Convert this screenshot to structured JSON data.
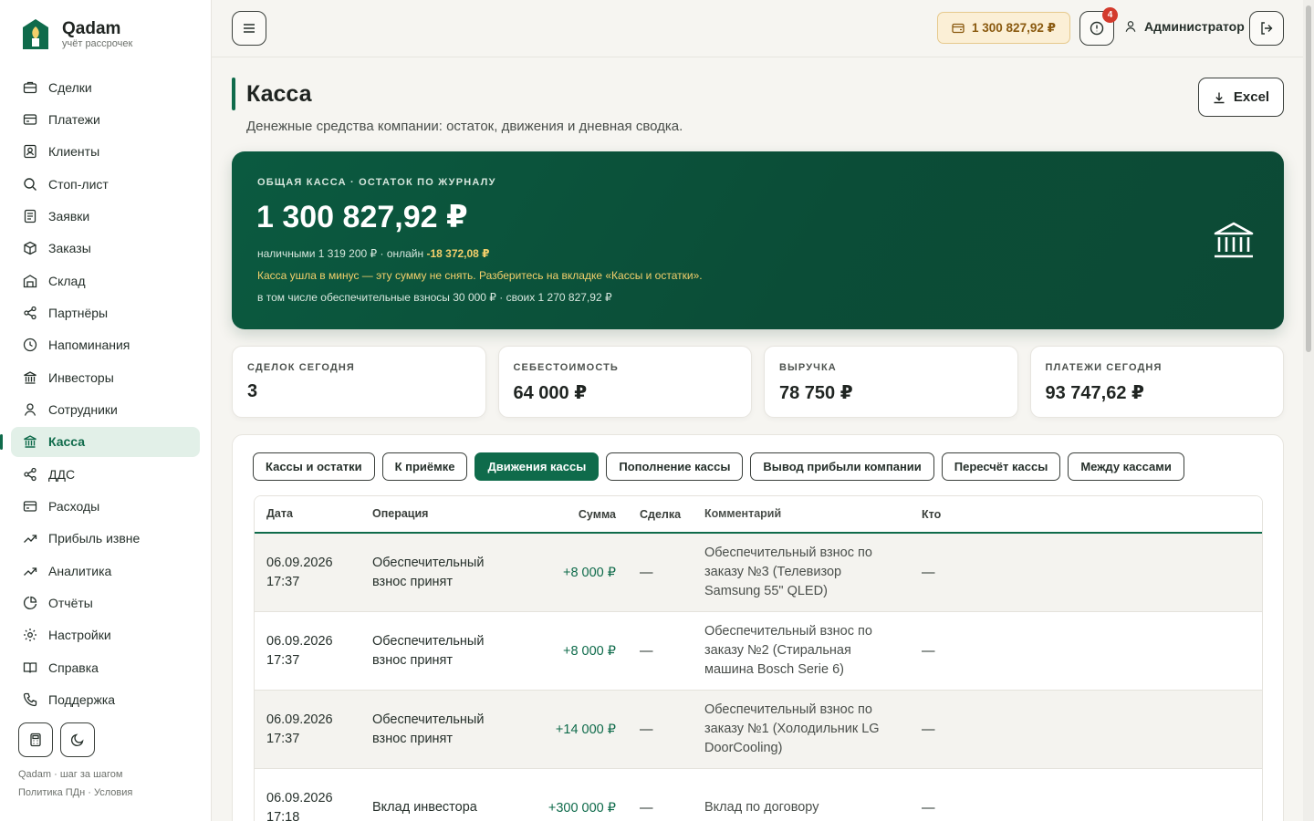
{
  "brand": {
    "name": "Qadam",
    "subtitle": "учёт рассрочек"
  },
  "sidebar": {
    "items": [
      {
        "label": "Сделки",
        "icon": "briefcase-icon"
      },
      {
        "label": "Платежи",
        "icon": "card-icon"
      },
      {
        "label": "Клиенты",
        "icon": "contact-icon"
      },
      {
        "label": "Стоп-лист",
        "icon": "search-icon"
      },
      {
        "label": "Заявки",
        "icon": "document-icon"
      },
      {
        "label": "Заказы",
        "icon": "box-icon"
      },
      {
        "label": "Склад",
        "icon": "warehouse-icon"
      },
      {
        "label": "Партнёры",
        "icon": "share-icon"
      },
      {
        "label": "Напоминания",
        "icon": "clock-icon"
      },
      {
        "label": "Инвесторы",
        "icon": "bank-icon"
      },
      {
        "label": "Сотрудники",
        "icon": "user-icon"
      },
      {
        "label": "Касса",
        "icon": "bank-icon",
        "active": true
      },
      {
        "label": "ДДС",
        "icon": "share-icon"
      },
      {
        "label": "Расходы",
        "icon": "card-icon"
      },
      {
        "label": "Прибыль извне",
        "icon": "trend-icon"
      },
      {
        "label": "Аналитика",
        "icon": "trend-icon"
      },
      {
        "label": "Отчёты",
        "icon": "pie-icon"
      },
      {
        "label": "Настройки",
        "icon": "gear-icon"
      },
      {
        "label": "Справка",
        "icon": "book-icon"
      },
      {
        "label": "Поддержка",
        "icon": "phone-icon"
      }
    ],
    "footer_line1": "Qadam · шаг за шагом",
    "footer_line2": "Политика ПДн · Условия"
  },
  "header": {
    "balance": "1 300 827,92 ₽",
    "alerts_count": "4",
    "user": "Администратор"
  },
  "page": {
    "title": "Касса",
    "subtitle": "Денежные средства компании: остаток, движения и дневная сводка.",
    "excel_label": "Excel"
  },
  "hero": {
    "label": "ОБЩАЯ КАССА · ОСТАТОК ПО ЖУРНАЛУ",
    "amount": "1 300 827,92 ₽",
    "split_prefix": "наличными 1 319 200 ₽ · онлайн ",
    "split_online": "-18 372,08 ₽",
    "warning": "Касса ушла в минус — эту сумму не снять. Разберитесь на вкладке «Кассы и остатки».",
    "deposits": "в том числе обеспечительные взносы 30 000 ₽ · своих 1 270 827,92 ₽"
  },
  "kpis": [
    {
      "label": "СДЕЛОК СЕГОДНЯ",
      "value": "3"
    },
    {
      "label": "СЕБЕСТОИМОСТЬ",
      "value": "64 000 ₽"
    },
    {
      "label": "ВЫРУЧКА",
      "value": "78 750 ₽"
    },
    {
      "label": "ПЛАТЕЖИ СЕГОДНЯ",
      "value": "93 747,62 ₽"
    }
  ],
  "tabs": [
    {
      "label": "Кассы и остатки"
    },
    {
      "label": "К приёмке"
    },
    {
      "label": "Движения кассы",
      "active": true
    },
    {
      "label": "Пополнение кассы"
    },
    {
      "label": "Вывод прибыли компании"
    },
    {
      "label": "Пересчёт кассы"
    },
    {
      "label": "Между кассами"
    }
  ],
  "table": {
    "columns": [
      "Дата",
      "Операция",
      "Сумма",
      "Сделка",
      "Комментарий",
      "Кто"
    ],
    "rows": [
      {
        "date": "06.09.2026",
        "time": "17:37",
        "op1": "Обеспечительный",
        "op2": "взнос принят",
        "sum": "+8 000 ₽",
        "deal": "—",
        "c1": "Обеспечительный взнос по",
        "c2": "заказу №3 (Телевизор",
        "c3": "Samsung 55\" QLED)",
        "who": "—"
      },
      {
        "date": "06.09.2026",
        "time": "17:37",
        "op1": "Обеспечительный",
        "op2": "взнос принят",
        "sum": "+8 000 ₽",
        "deal": "—",
        "c1": "Обеспечительный взнос по",
        "c2": "заказу №2 (Стиральная",
        "c3": "машина Bosch Serie 6)",
        "who": "—"
      },
      {
        "date": "06.09.2026",
        "time": "17:37",
        "op1": "Обеспечительный",
        "op2": "взнос принят",
        "sum": "+14 000 ₽",
        "deal": "—",
        "c1": "Обеспечительный взнос по",
        "c2": "заказу №1 (Холодильник LG",
        "c3": "DoorCooling)",
        "who": "—"
      },
      {
        "date": "06.09.2026",
        "time": "17:18",
        "op1": "Вклад инвестора",
        "op2": "",
        "sum": "+300 000 ₽",
        "deal": "—",
        "c1": "Вклад по договору",
        "c2": "",
        "c3": "",
        "who": "—"
      }
    ]
  },
  "colors": {
    "accent": "#0f6b4b",
    "warning": "#f2cf6b",
    "balance_chip": "#fbefd6",
    "badge": "#d33a2c"
  }
}
